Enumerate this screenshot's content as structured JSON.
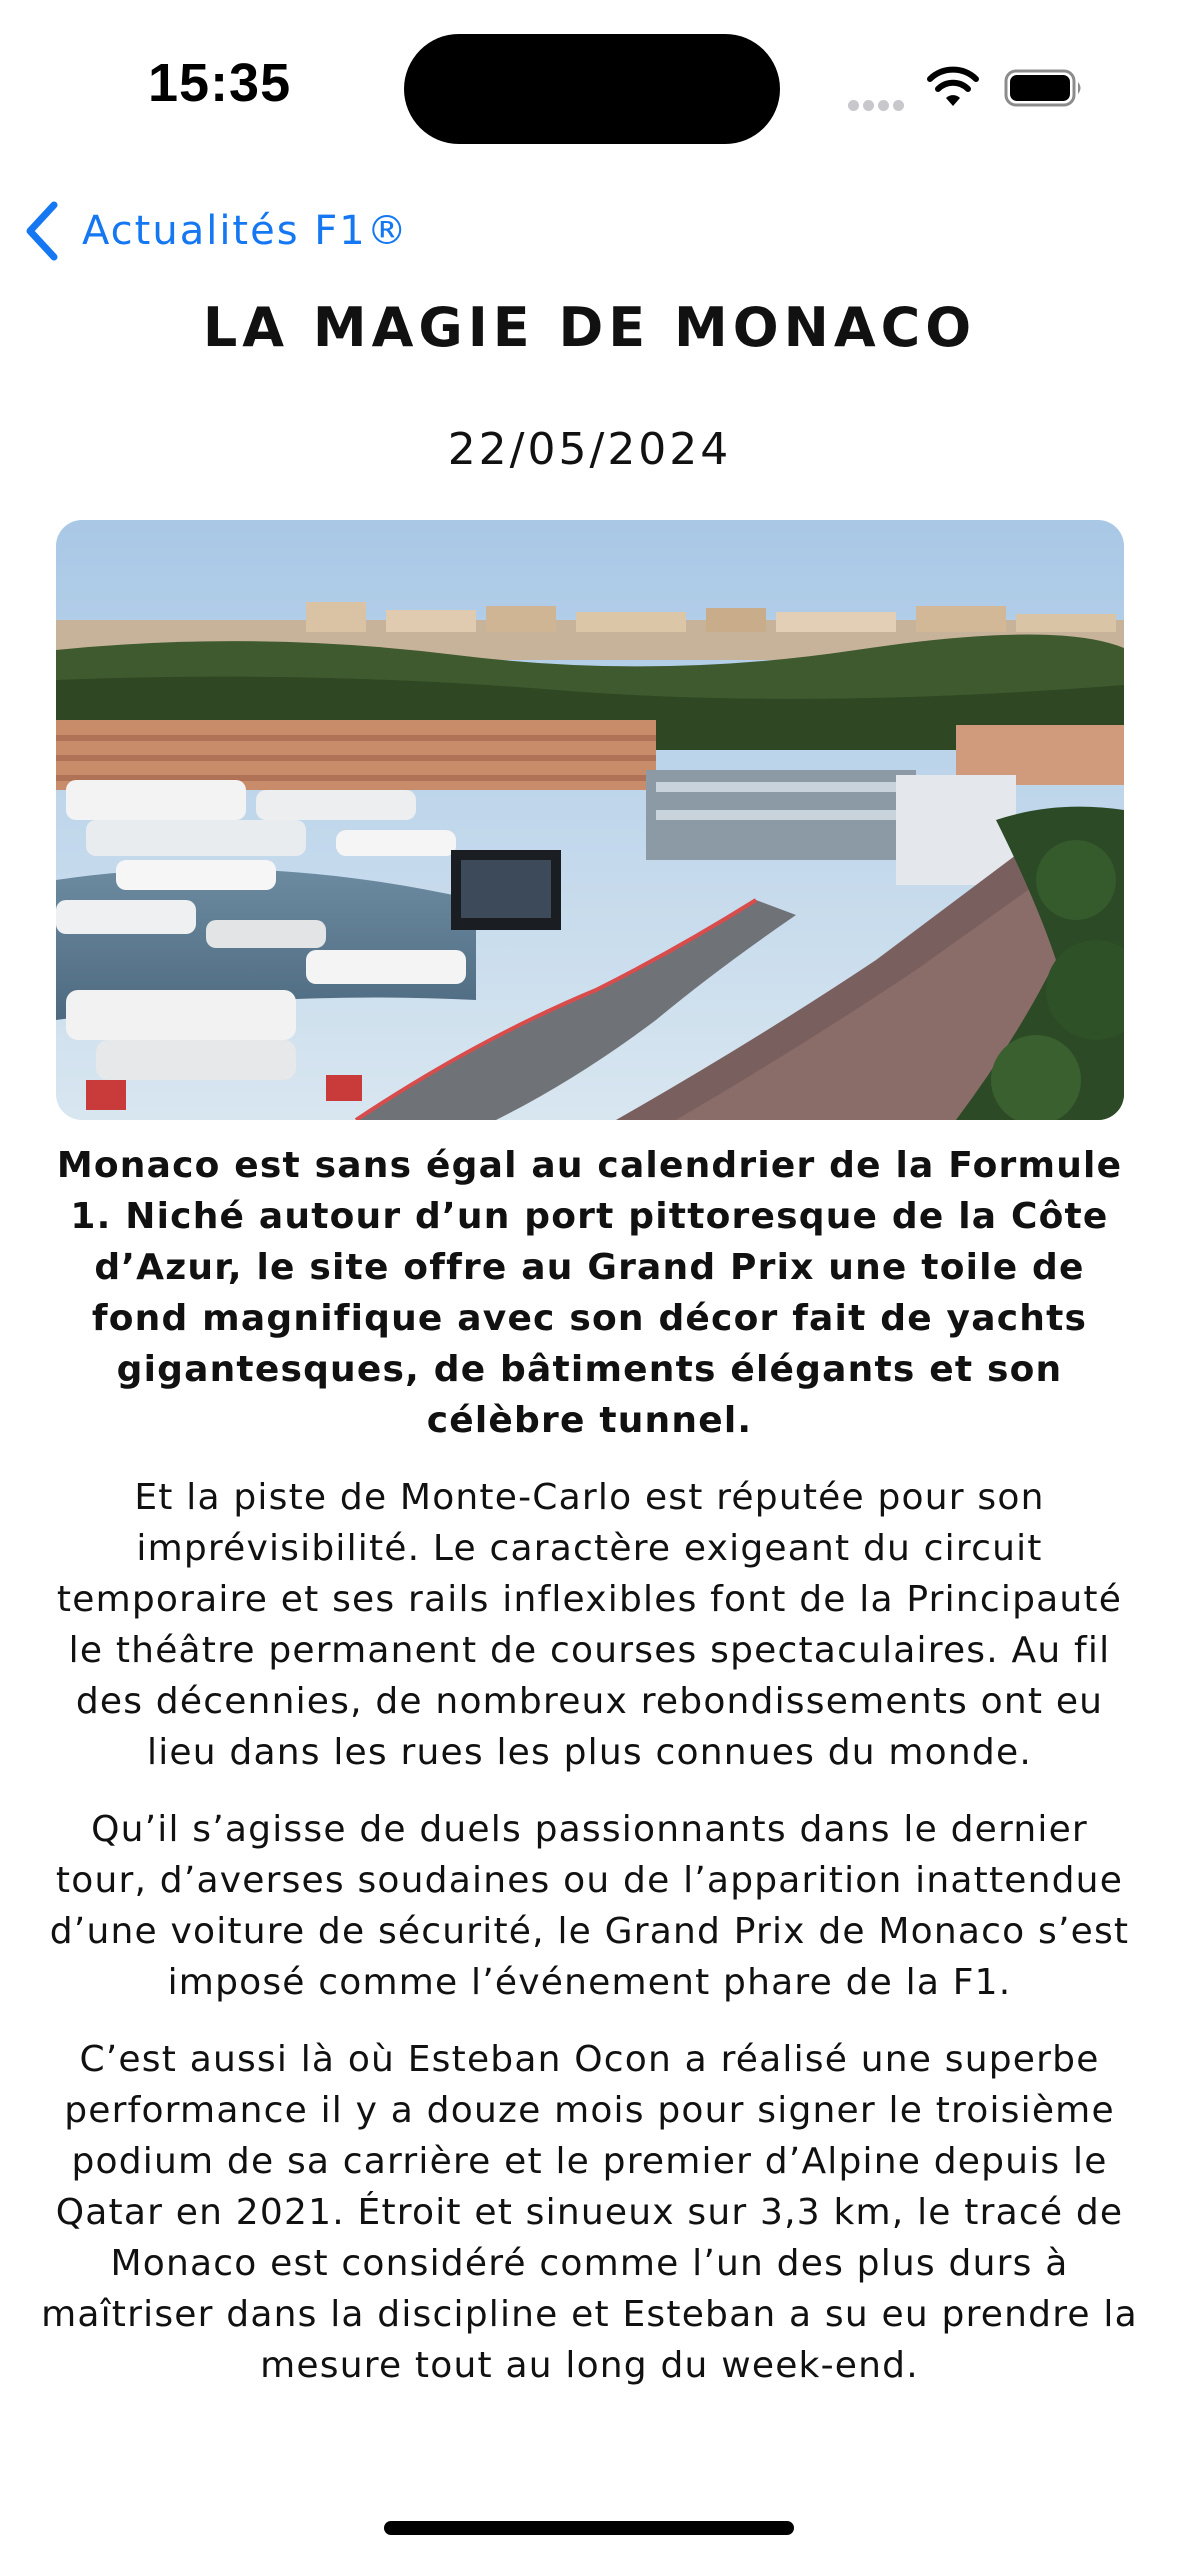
{
  "status_bar": {
    "time": "15:35",
    "icons": [
      "cellular-signal-icon",
      "wifi-icon",
      "battery-icon"
    ]
  },
  "nav": {
    "back_label": "Actualités F1®",
    "back_icon": "chevron-left-icon",
    "accent_color": "#1577f2"
  },
  "article": {
    "title": "LA MAGIE DE MONACO",
    "date": "22/05/2024",
    "lead": "Monaco est sans égal au calendrier de la Formule 1. Niché autour d’un port pittoresque de la Côte d’Azur, le site offre au Grand Prix une toile de fond magnifique avec son décor fait de yachts gigantesques, de bâtiments élégants et son célèbre tunnel.",
    "paragraphs": [
      "Et la piste de Monte-Carlo est réputée pour son imprévisibilité. Le caractère exigeant du circuit temporaire et ses rails inflexibles font de la Principauté le théâtre permanent de courses spectaculaires. Au fil des décennies, de nombreux rebondissements ont eu lieu dans les rues les plus connues du monde.",
      "Qu’il s’agisse de duels passionnants dans le dernier tour, d’averses soudaines ou de l’apparition inattendue d’une voiture de sécurité, le Grand Prix de Monaco s’est imposé comme l’événement phare de la F1.",
      "C’est aussi là où Esteban Ocon a réalisé une superbe performance il y a douze mois pour signer le troisième podium de sa carrière et le premier d’Alpine depuis le Qatar en 2021. Étroit et sinueux sur 3,3 km, le tracé de Monaco est considéré comme l’un des plus durs à maîtriser dans la discipline et Esteban a su eu prendre la mesure tout au long du week-end."
    ]
  }
}
